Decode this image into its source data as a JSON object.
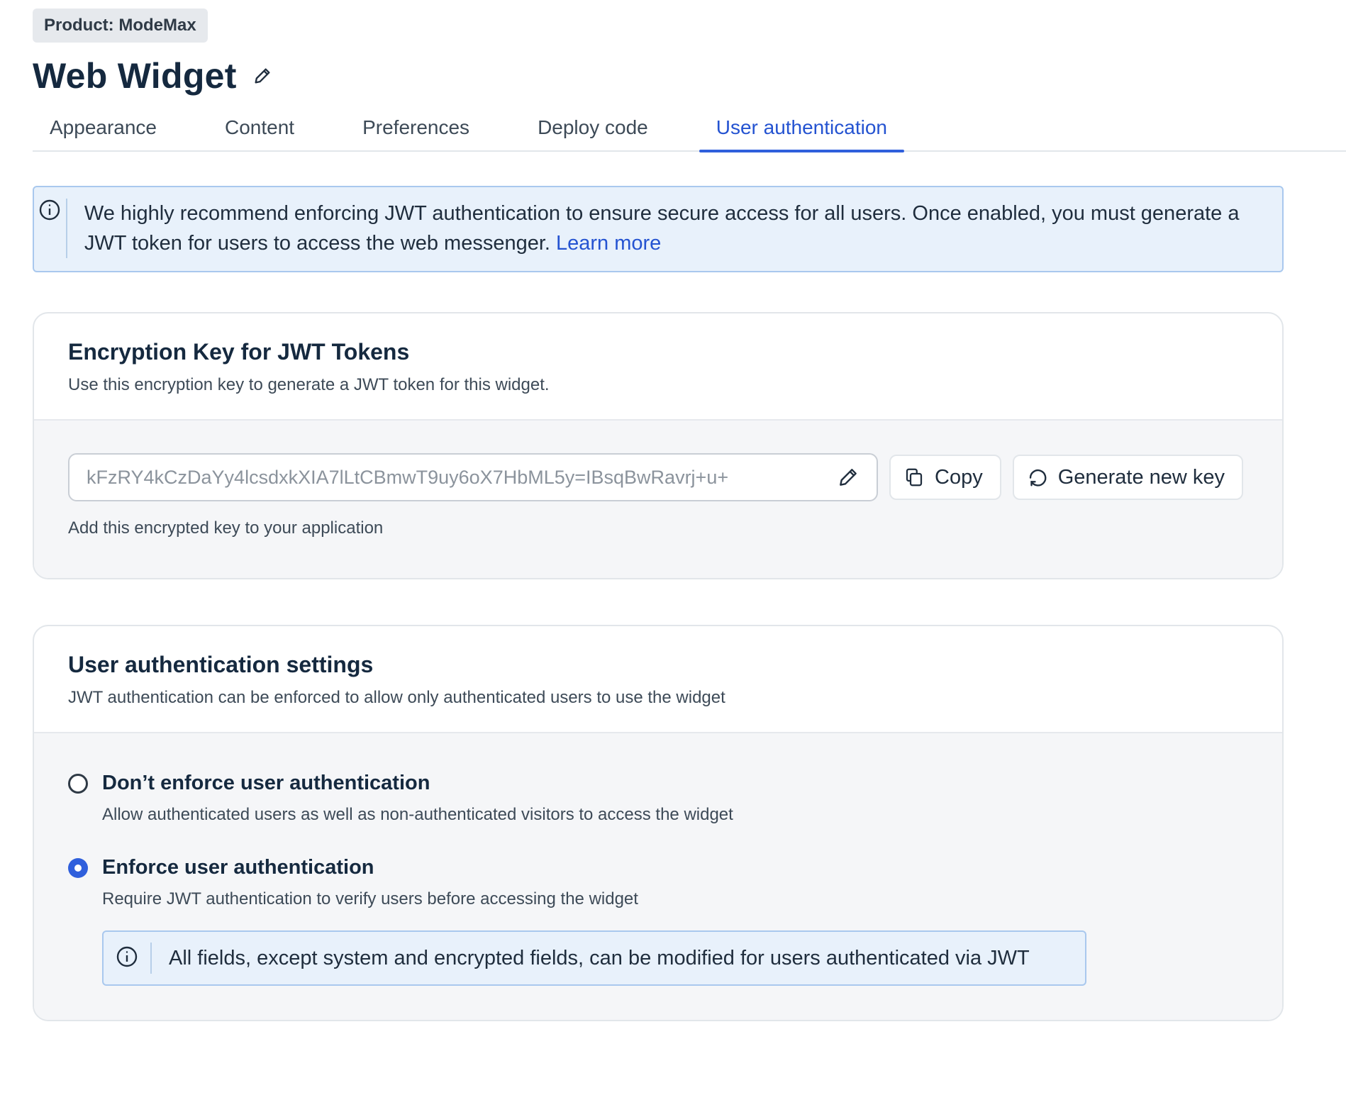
{
  "product_badge": "Product: ModeMax",
  "page_title": "Web Widget",
  "tabs": [
    {
      "label": "Appearance",
      "active": false
    },
    {
      "label": "Content",
      "active": false
    },
    {
      "label": "Preferences",
      "active": false
    },
    {
      "label": "Deploy code",
      "active": false
    },
    {
      "label": "User authentication",
      "active": true
    }
  ],
  "info_banner": {
    "text": "We highly recommend enforcing JWT authentication to ensure secure access for all users. Once enabled, you must generate a JWT token for users to access the web messenger.",
    "link": "Learn more"
  },
  "encryption_card": {
    "title": "Encryption Key for JWT Tokens",
    "subtitle": "Use this encryption key to generate a JWT token for this widget.",
    "key_value": "kFzRY4kCzDaYy4lcsdxkXIA7lLtCBmwT9uy6oX7HbML5y=IBsqBwRavrj+u+",
    "copy_label": "Copy",
    "generate_label": "Generate new key",
    "helper": "Add this encrypted key to your application"
  },
  "auth_card": {
    "title": "User authentication settings",
    "subtitle": "JWT authentication can be enforced to allow only authenticated users to use the widget",
    "options": [
      {
        "label": "Don’t enforce user authentication",
        "description": "Allow authenticated users as well as non-authenticated visitors to access the widget",
        "selected": false
      },
      {
        "label": "Enforce user authentication",
        "description": "Require JWT authentication to verify users before accessing the widget",
        "selected": true
      }
    ],
    "note": "All fields, except system and encrypted fields, can be modified for users authenticated via JWT"
  },
  "colors": {
    "accent": "#2f5fdc",
    "info_background": "#e8f1fb",
    "info_border": "#a9c8ee"
  },
  "icons": [
    "pencil-icon",
    "info-icon",
    "copy-icon",
    "refresh-icon"
  ]
}
